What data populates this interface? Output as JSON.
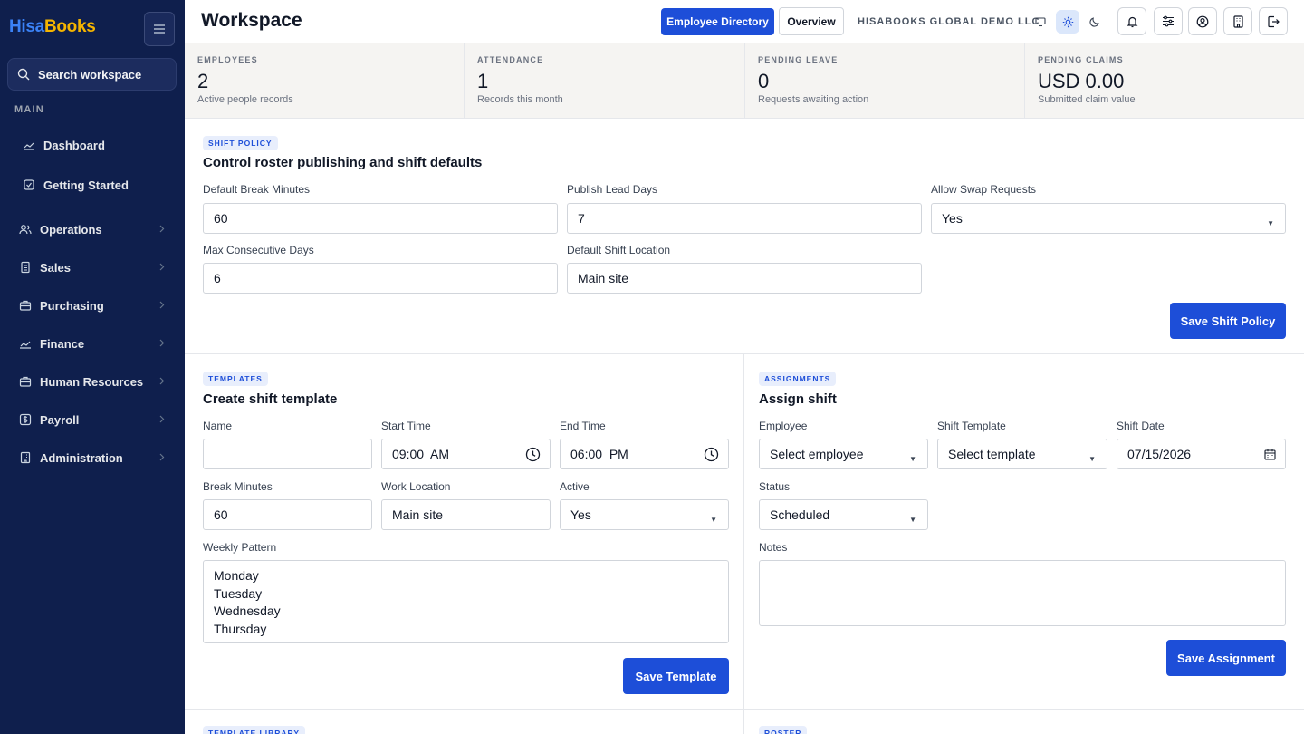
{
  "brand": {
    "logo_part1": "Hisa",
    "logo_part2": "Books"
  },
  "sidebar": {
    "search_label": "Search workspace",
    "section_main": "MAIN",
    "items": [
      {
        "label": "Dashboard",
        "icon": "chart-line-icon"
      },
      {
        "label": "Getting Started",
        "icon": "check-square-icon"
      },
      {
        "label": "Operations",
        "icon": "users-icon"
      },
      {
        "label": "Sales",
        "icon": "receipt-icon"
      },
      {
        "label": "Purchasing",
        "icon": "briefcase-icon"
      },
      {
        "label": "Finance",
        "icon": "chart-line-icon"
      },
      {
        "label": "Human Resources",
        "icon": "briefcase-icon"
      },
      {
        "label": "Payroll",
        "icon": "dollar-icon"
      },
      {
        "label": "Administration",
        "icon": "building-icon"
      }
    ]
  },
  "header": {
    "title": "Workspace",
    "employee_directory": "Employee Directory",
    "overview": "Overview",
    "company": "HISABOOKS GLOBAL DEMO LLC"
  },
  "stats": [
    {
      "label": "EMPLOYEES",
      "value": "2",
      "sub": "Active people records"
    },
    {
      "label": "ATTENDANCE",
      "value": "1",
      "sub": "Records this month"
    },
    {
      "label": "PENDING LEAVE",
      "value": "0",
      "sub": "Requests awaiting action"
    },
    {
      "label": "PENDING CLAIMS",
      "value": "USD 0.00",
      "sub": "Submitted claim value"
    }
  ],
  "shift_policy": {
    "tag": "SHIFT POLICY",
    "title": "Control roster publishing and shift defaults",
    "break_label": "Default Break Minutes",
    "break_value": "60",
    "lead_label": "Publish Lead Days",
    "lead_value": "7",
    "swap_label": "Allow Swap Requests",
    "swap_value": "Yes",
    "maxdays_label": "Max Consecutive Days",
    "maxdays_value": "6",
    "location_label": "Default Shift Location",
    "location_value": "Main site",
    "save": "Save Shift Policy"
  },
  "templates": {
    "tag": "TEMPLATES",
    "title": "Create shift template",
    "name_label": "Name",
    "name_value": "",
    "start_label": "Start Time",
    "start_value": "09:00  AM",
    "end_label": "End Time",
    "end_value": "06:00  PM",
    "break_label": "Break Minutes",
    "break_value": "60",
    "location_label": "Work Location",
    "location_value": "Main site",
    "active_label": "Active",
    "active_value": "Yes",
    "pattern_label": "Weekly Pattern",
    "pattern_value": "Monday\nTuesday\nWednesday\nThursday\nFriday",
    "save": "Save Template"
  },
  "assignments": {
    "tag": "ASSIGNMENTS",
    "title": "Assign shift",
    "employee_label": "Employee",
    "employee_value": "Select employee",
    "template_label": "Shift Template",
    "template_value": "Select template",
    "date_label": "Shift Date",
    "date_value": "07/15/2026",
    "status_label": "Status",
    "status_value": "Scheduled",
    "notes_label": "Notes",
    "notes_value": "",
    "save": "Save Assignment"
  },
  "bottom": {
    "left_tag": "TEMPLATE LIBRARY",
    "right_tag": "ROSTER"
  },
  "colors": {
    "sidebar_bg": "#0f1f4d",
    "primary": "#1d4ed8",
    "logo_accent": "#f5b400",
    "logo_blue": "#3b82f6"
  }
}
